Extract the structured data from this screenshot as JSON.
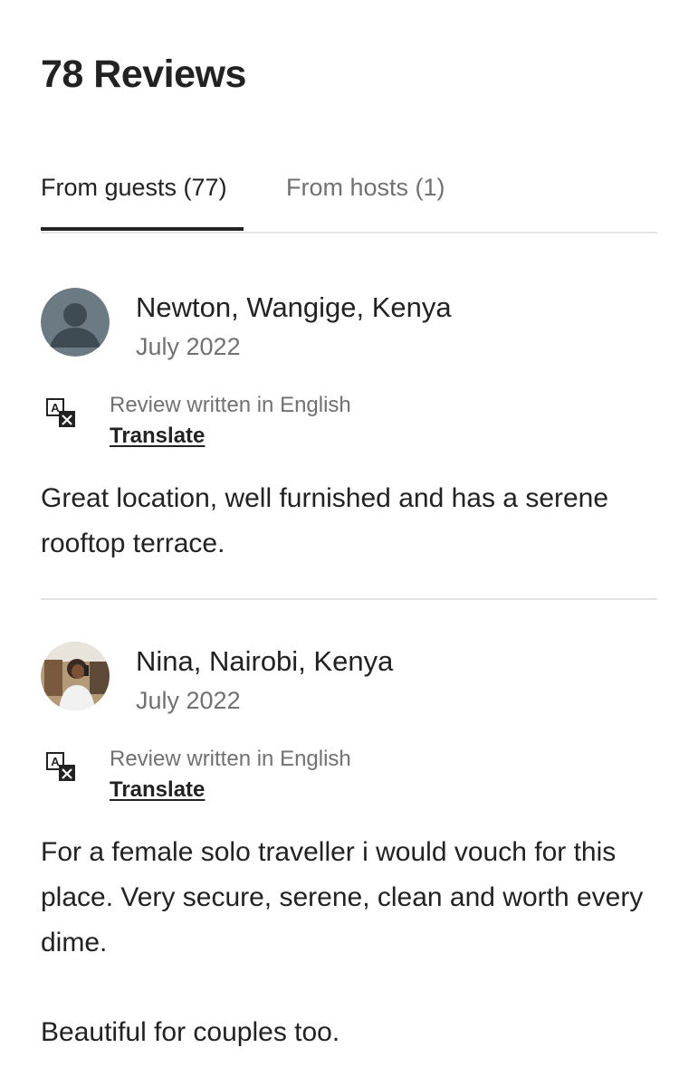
{
  "header": {
    "title": "78 Reviews"
  },
  "tabs": [
    {
      "label": "From guests (77)",
      "active": true
    },
    {
      "label": "From hosts (1)",
      "active": false
    }
  ],
  "colors": {
    "primary_text": "#222222",
    "secondary_text": "#717171",
    "divider": "#e4e4e4"
  },
  "reviews": [
    {
      "name": "Newton, Wangige, Kenya",
      "date": "July 2022",
      "avatar_icon": "default-user-avatar-icon",
      "language_note": "Review written in English",
      "translate_label": "Translate",
      "text": "Great location, well furnished and has a serene rooftop terrace."
    },
    {
      "name": "Nina, Nairobi, Kenya",
      "date": "July 2022",
      "avatar_icon": "user-photo-avatar",
      "language_note": "Review written in English",
      "translate_label": "Translate",
      "text_paragraphs": [
        "For a female solo traveller i would vouch for this place. Very secure, serene, clean and worth every dime.",
        "Beautiful for couples too."
      ]
    }
  ]
}
